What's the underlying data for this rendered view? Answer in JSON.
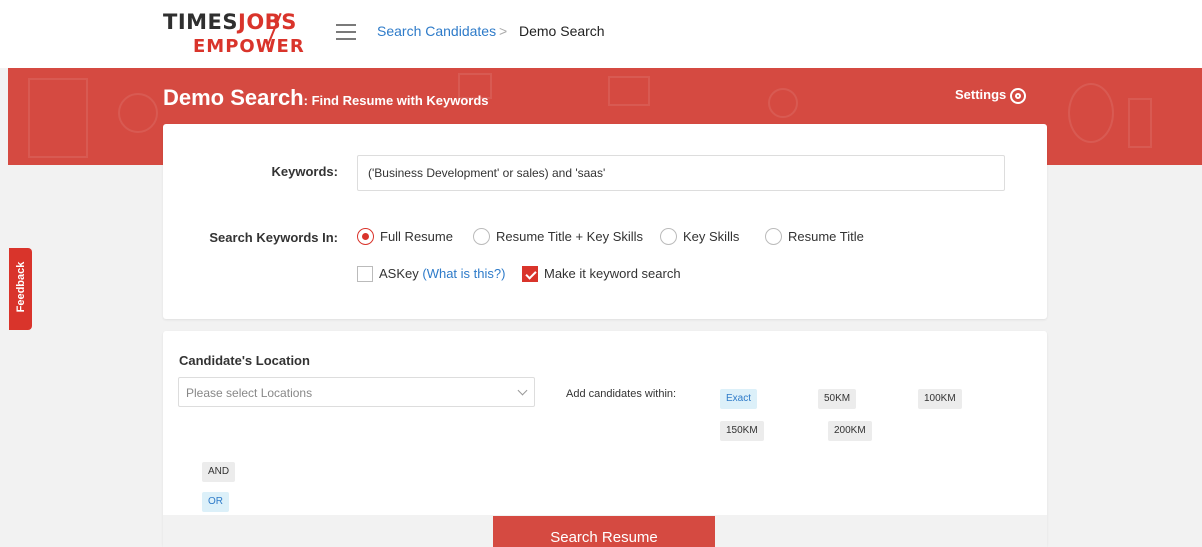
{
  "logo": {
    "line1_part1": "TIMES",
    "line1_part2": "JOBS",
    "line2": "EMPOWER"
  },
  "breadcrumb": {
    "link": "Search Candidates",
    "separator": ">",
    "current": "Demo Search"
  },
  "banner": {
    "title": "Demo Search",
    "subtitle": ": Find Resume with Keywords",
    "settings_label": "Settings"
  },
  "feedback_label": "Feedback",
  "keywords": {
    "label": "Keywords:",
    "value": "('Business Development' or sales) and 'saas'",
    "search_in_label": "Search Keywords In:",
    "options": [
      {
        "label": "Full Resume",
        "selected": true
      },
      {
        "label": "Resume Title + Key Skills",
        "selected": false
      },
      {
        "label": "Key Skills",
        "selected": false
      },
      {
        "label": "Resume Title",
        "selected": false
      }
    ],
    "askey_label": "ASKey",
    "askey_link": "(What is this?)",
    "askey_checked": false,
    "keyword_search_label": "Make it keyword search",
    "keyword_search_checked": true
  },
  "location": {
    "title": "Candidate's Location",
    "placeholder": "Please select Locations",
    "within_label": "Add candidates within:",
    "distances": [
      "Exact",
      "50KM",
      "100KM",
      "150KM",
      "200KM"
    ],
    "active_distance": "Exact",
    "operators": [
      "AND",
      "OR"
    ],
    "active_operator": "OR"
  },
  "search_button": "Search Resume",
  "colors": {
    "brand_red": "#d54a41",
    "link_blue": "#2e7bc9"
  }
}
